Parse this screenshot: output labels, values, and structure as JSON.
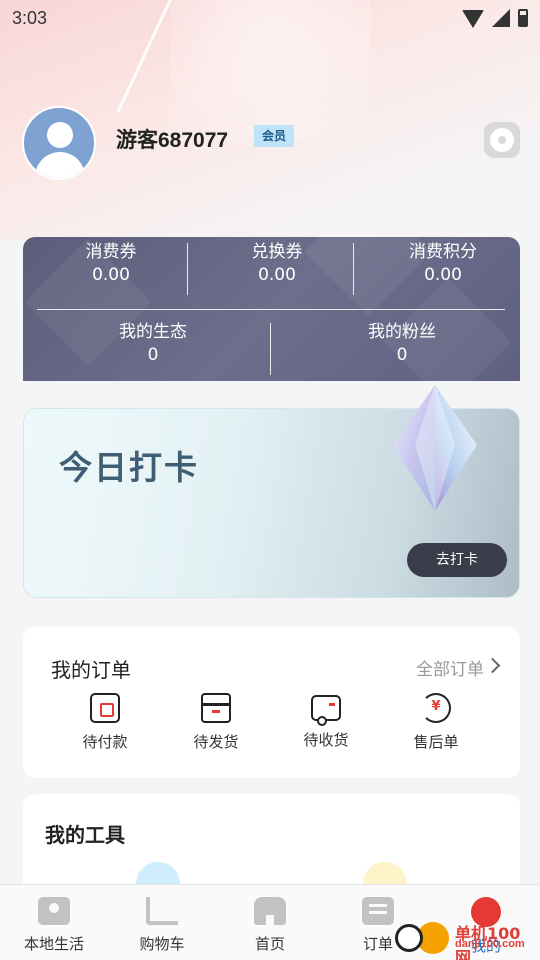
{
  "status_bar": {
    "time": "3:03"
  },
  "profile": {
    "username": "游客687077",
    "badge": "会员"
  },
  "stats": {
    "row1": [
      {
        "label": "消费券",
        "value": "0.00"
      },
      {
        "label": "兑换券",
        "value": "0.00"
      },
      {
        "label": "消费积分",
        "value": "0.00"
      }
    ],
    "row2": [
      {
        "label": "我的生态",
        "value": "0"
      },
      {
        "label": "我的粉丝",
        "value": "0"
      }
    ]
  },
  "checkin": {
    "title": "今日打卡",
    "button": "去打卡"
  },
  "orders": {
    "title": "我的订单",
    "all_label": "全部订单",
    "items": [
      {
        "label": "待付款",
        "icon": "wallet-icon"
      },
      {
        "label": "待发货",
        "icon": "box-icon"
      },
      {
        "label": "待收货",
        "icon": "truck-icon"
      },
      {
        "label": "售后单",
        "icon": "refund-icon"
      }
    ]
  },
  "tools": {
    "title": "我的工具"
  },
  "tabbar": {
    "items": [
      {
        "label": "本地生活",
        "icon": "map-icon"
      },
      {
        "label": "购物车",
        "icon": "cart-icon"
      },
      {
        "label": "首页",
        "icon": "home-icon"
      },
      {
        "label": "订单",
        "icon": "list-icon"
      },
      {
        "label": "我的",
        "icon": "profile-icon"
      }
    ],
    "active_color": "#1e73c8"
  },
  "watermark": {
    "text": "单机100网",
    "sub": "danji100.com"
  },
  "colors": {
    "accent": "#e53935",
    "card_dark": "#5c5d7a"
  }
}
